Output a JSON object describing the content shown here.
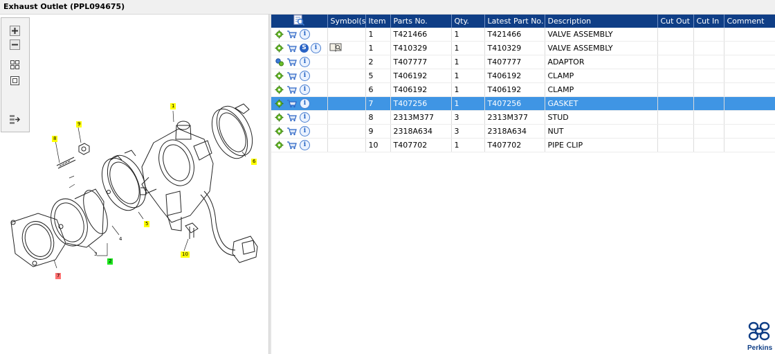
{
  "title": "Exhaust Outlet (PPL094675)",
  "toolbar": {
    "zoom_in": "zoom-in-icon",
    "zoom_out": "zoom-out-icon",
    "fit": "fit-window-icon",
    "actual": "actual-size-icon",
    "export": "export-icon"
  },
  "colors": {
    "header_bg": "#0f3e86",
    "selected_row": "#3f95e4",
    "callout_yellow": "#ffff00",
    "callout_green": "#1ee61e",
    "callout_red": "#ff7070"
  },
  "callouts": [
    "1",
    "9",
    "8",
    "6",
    "5",
    "3",
    "4",
    "2",
    "7",
    "10"
  ],
  "table": {
    "columns": [
      "",
      "Symbol(s)",
      "Item",
      "Parts No.",
      "Qty.",
      "Latest Part No.",
      "Description",
      "Cut Out",
      "Cut In",
      "Comment"
    ],
    "rows": [
      {
        "item": "1",
        "part": "T421466",
        "qty": "1",
        "latest": "T421466",
        "desc": "VALVE ASSEMBLY",
        "cut_out": "",
        "cut_in": "",
        "comment": ""
      },
      {
        "item": "1",
        "part": "T410329",
        "qty": "1",
        "latest": "T410329",
        "desc": "VALVE ASSEMBLY",
        "cut_out": "",
        "cut_in": "",
        "comment": ""
      },
      {
        "item": "2",
        "part": "T407777",
        "qty": "1",
        "latest": "T407777",
        "desc": "ADAPTOR",
        "cut_out": "",
        "cut_in": "",
        "comment": ""
      },
      {
        "item": "5",
        "part": "T406192",
        "qty": "1",
        "latest": "T406192",
        "desc": "CLAMP",
        "cut_out": "",
        "cut_in": "",
        "comment": ""
      },
      {
        "item": "6",
        "part": "T406192",
        "qty": "1",
        "latest": "T406192",
        "desc": "CLAMP",
        "cut_out": "",
        "cut_in": "",
        "comment": ""
      },
      {
        "item": "7",
        "part": "T407256",
        "qty": "1",
        "latest": "T407256",
        "desc": "GASKET",
        "cut_out": "",
        "cut_in": "",
        "comment": ""
      },
      {
        "item": "8",
        "part": "2313M377",
        "qty": "3",
        "latest": "2313M377",
        "desc": "STUD",
        "cut_out": "",
        "cut_in": "",
        "comment": ""
      },
      {
        "item": "9",
        "part": "2318A634",
        "qty": "3",
        "latest": "2318A634",
        "desc": "NUT",
        "cut_out": "",
        "cut_in": "",
        "comment": ""
      },
      {
        "item": "10",
        "part": "T407702",
        "qty": "1",
        "latest": "T407702",
        "desc": "PIPE CLIP",
        "cut_out": "",
        "cut_in": "",
        "comment": ""
      }
    ]
  },
  "logo_text": "Perkins"
}
